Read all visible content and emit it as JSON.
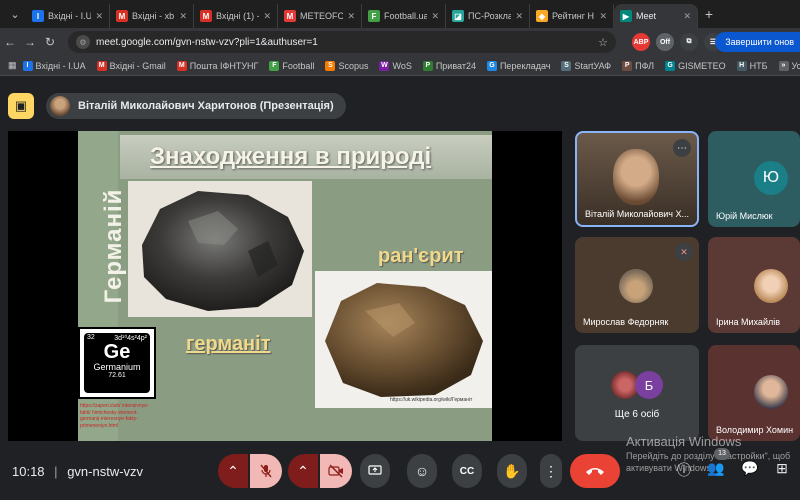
{
  "tabs": [
    {
      "label": "Вхідні - I.UA",
      "fav": "I",
      "color": "#1a73e8"
    },
    {
      "label": "Вхідні - xb",
      "fav": "M",
      "color": "#d93025"
    },
    {
      "label": "Вхідні (1) -",
      "fav": "M",
      "color": "#d93025"
    },
    {
      "label": "METEOFOR",
      "fav": "M",
      "color": "#e53935"
    },
    {
      "label": "Football.ua",
      "fav": "F",
      "color": "#43a047"
    },
    {
      "label": "ПС-Розклад",
      "fav": "◪",
      "color": "#26a69a"
    },
    {
      "label": "Рейтинг Н",
      "fav": "◈",
      "color": "#f9a825"
    },
    {
      "label": "Meet",
      "fav": "▶",
      "color": "#00897b",
      "active": true
    }
  ],
  "address": {
    "url": "meet.google.com/gvn-nstw-vzv?pli=1&authuser=1"
  },
  "toolbar": {
    "finish_label": "Завершити онов"
  },
  "extensions": [
    {
      "label": "ABP",
      "color": "#e53935"
    },
    {
      "label": "Off",
      "color": "#5f6368"
    },
    {
      "label": "⧉",
      "color": "#3c4043"
    },
    {
      "label": "☰",
      "color": "#3c4043"
    }
  ],
  "bookmarks": [
    {
      "label": "Вхідні - I.UA",
      "icon": "I",
      "color": "#1a73e8"
    },
    {
      "label": "Вхідні - Gmail",
      "icon": "M",
      "color": "#d93025"
    },
    {
      "label": "Пошта ІФНТУНГ",
      "icon": "M",
      "color": "#d93025"
    },
    {
      "label": "Football",
      "icon": "F",
      "color": "#43a047"
    },
    {
      "label": "Scopus",
      "icon": "S",
      "color": "#f57c00"
    },
    {
      "label": "WoS",
      "icon": "W",
      "color": "#7b1fa2"
    },
    {
      "label": "Приват24",
      "icon": "P",
      "color": "#2e7d32"
    },
    {
      "label": "Перекладач",
      "icon": "G",
      "color": "#1e88e5"
    },
    {
      "label": "StartУАФ",
      "icon": "S",
      "color": "#546e7a"
    },
    {
      "label": "ПФЛ",
      "icon": "P",
      "color": "#6d4c41"
    },
    {
      "label": "GISMETEO",
      "icon": "G",
      "color": "#00838f"
    },
    {
      "label": "НТБ",
      "icon": "Н",
      "color": "#455a64"
    },
    {
      "label": "Усі",
      "icon": "»",
      "color": "#5f6368"
    }
  ],
  "meet": {
    "presenter": "Віталій Миколайович Харитонов (Презентація)",
    "slide": {
      "vertical_title": "Германій",
      "title": "Знаходження в природі",
      "label_ranerite": "ран'єрит",
      "label_germanite": "германіт",
      "element": {
        "number": "32",
        "config": "3d¹⁰4s²4p²",
        "symbol": "Ge",
        "name": "Germanium",
        "mass": "72.61"
      },
      "cite_left": "https://zaperi.club/ intensivnye-fakti/ himichesky-element- germanij-interesnye-fakty- primeneniye.html",
      "cite_right": "https://uk.wikipedia.org/wiki/Германіт"
    },
    "participants": {
      "p1": "Віталій Миколайович Х...",
      "p2": "Юрій Мислюк",
      "p2_initial": "Ю",
      "p3": "Мирослав Федорняк",
      "p4": "Ірина Михайлів",
      "p5": "Ще 6 осіб",
      "p5_initial": "Б",
      "p6": "Володимир Хомин"
    },
    "bottom": {
      "time": "10:18",
      "separator": "|",
      "meeting_code": "gvn-nstw-vzv",
      "participants_count": "13"
    }
  },
  "windows": {
    "activate_title": "Активація Windows",
    "activate_sub1": "Перейдіть до розділу \"Настройки\", щоб",
    "activate_sub2": "активувати Windows."
  }
}
